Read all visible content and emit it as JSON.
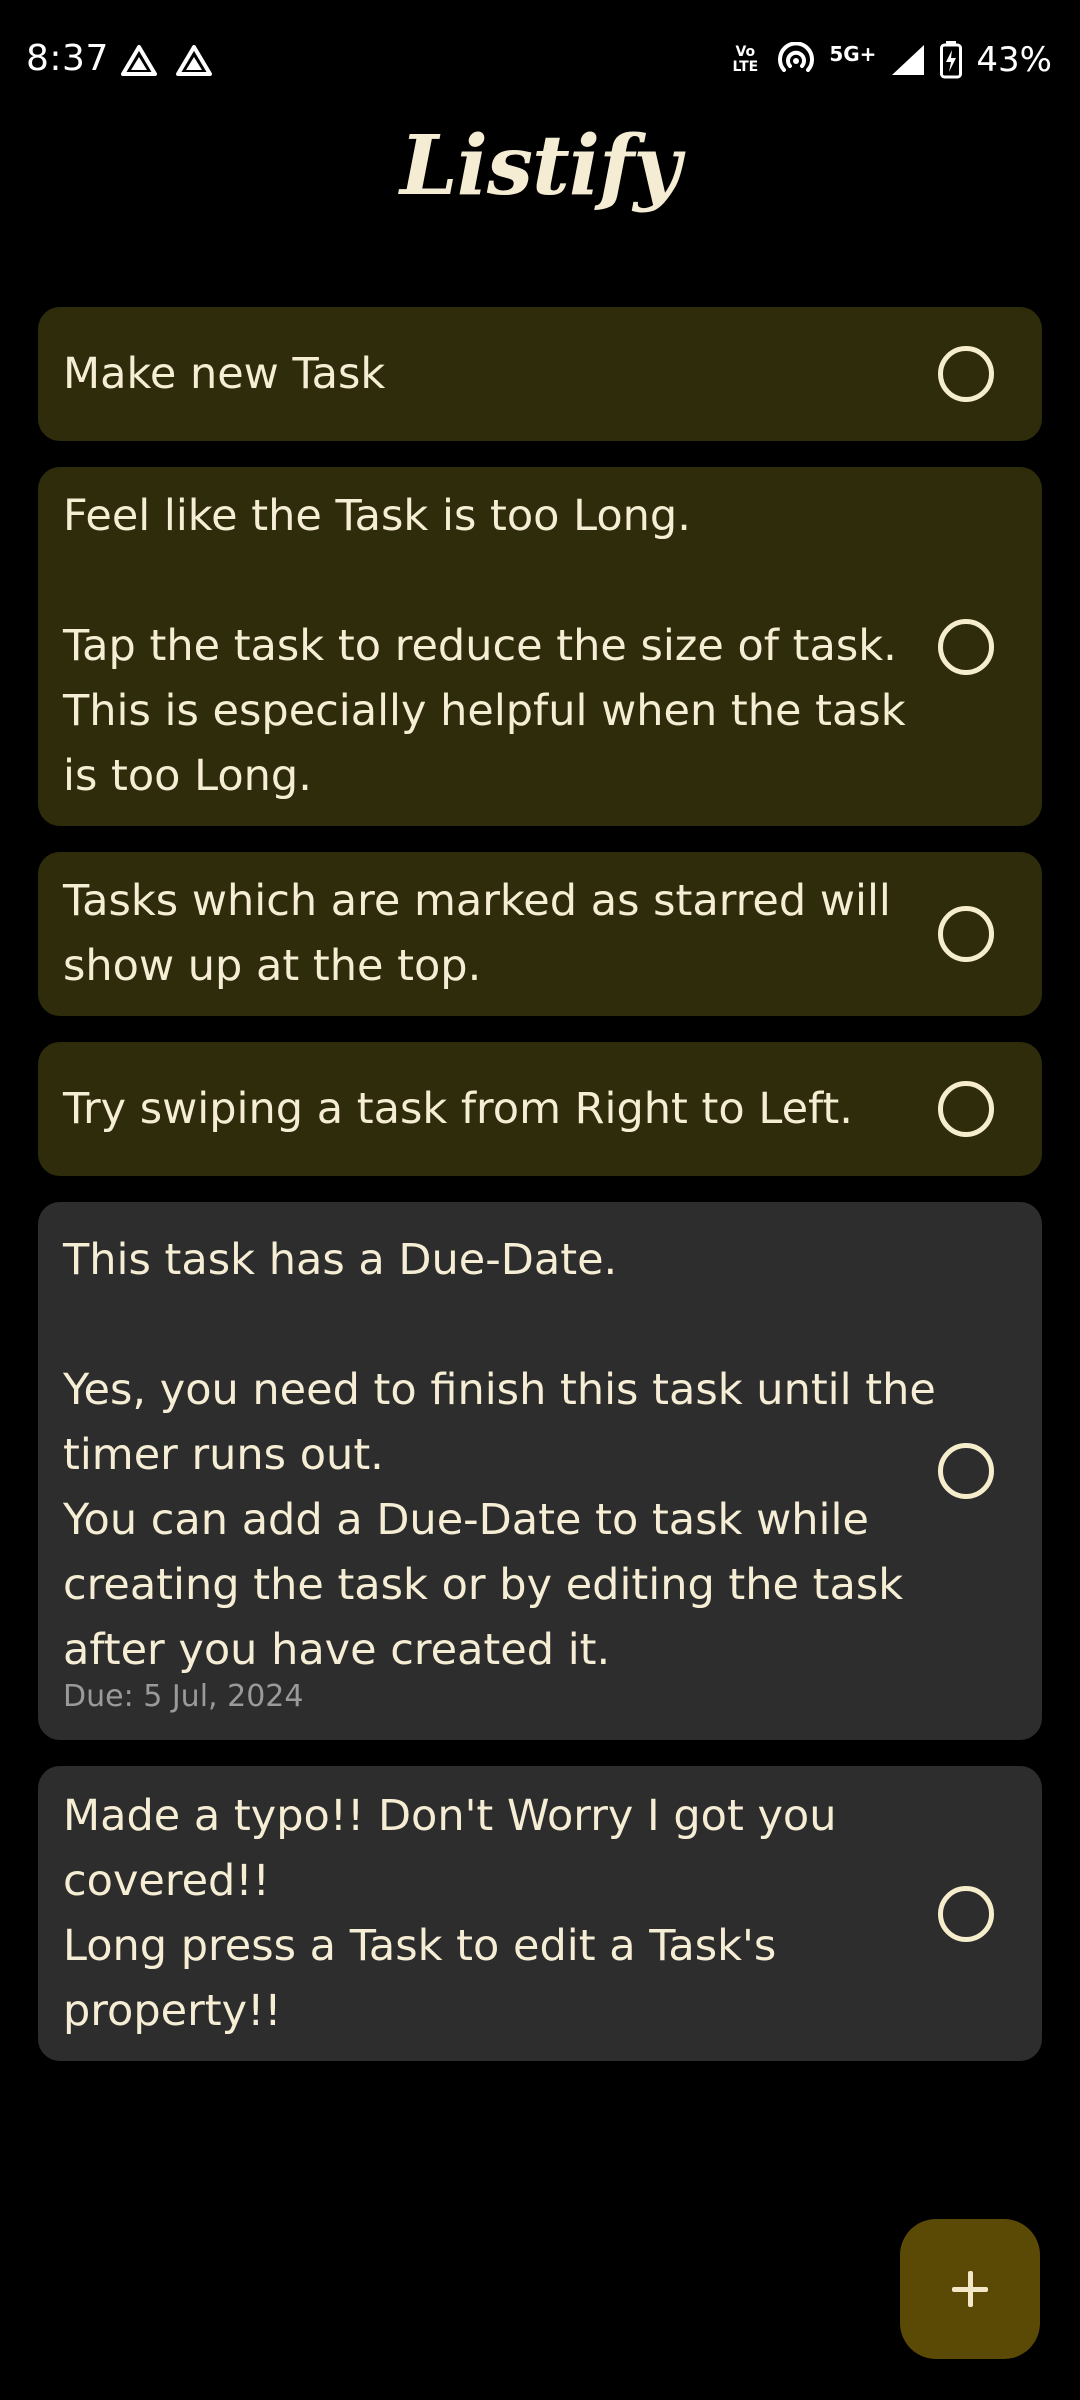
{
  "status_bar": {
    "time": "8:37",
    "network_label": "5G+",
    "volte_label": "Vo LTE",
    "battery_percent": "43%"
  },
  "app": {
    "title": "Listify"
  },
  "tasks": [
    {
      "text": "Make new Task",
      "starred": true,
      "due": ""
    },
    {
      "text": "Feel like the Task is too Long.\n\nTap the task to reduce the size of task.\nThis is especially helpful when the task is too Long.",
      "starred": true,
      "due": ""
    },
    {
      "text": "Tasks which are marked as starred will show up at the top.",
      "starred": true,
      "due": ""
    },
    {
      "text": "Try swiping a task from Right to Left.",
      "starred": true,
      "due": ""
    },
    {
      "text": "This task has a Due-Date.\n\nYes, you need to finish this task until the timer runs out.\nYou can add a Due-Date to task while creating the task or by editing the task after you have created it.",
      "starred": false,
      "due": "Due: 5 Jul, 2024"
    },
    {
      "text": "Made a typo!! Don't Worry I got you covered!!\nLong press a Task to edit a Task's property!!",
      "starred": false,
      "due": ""
    }
  ],
  "fab": {
    "icon": "plus-icon"
  },
  "colors": {
    "background": "#000000",
    "starred_card": "#2e2c0b",
    "normal_card": "#2d2d2d",
    "text": "#f6edd5",
    "fab": "#5a4a06"
  }
}
